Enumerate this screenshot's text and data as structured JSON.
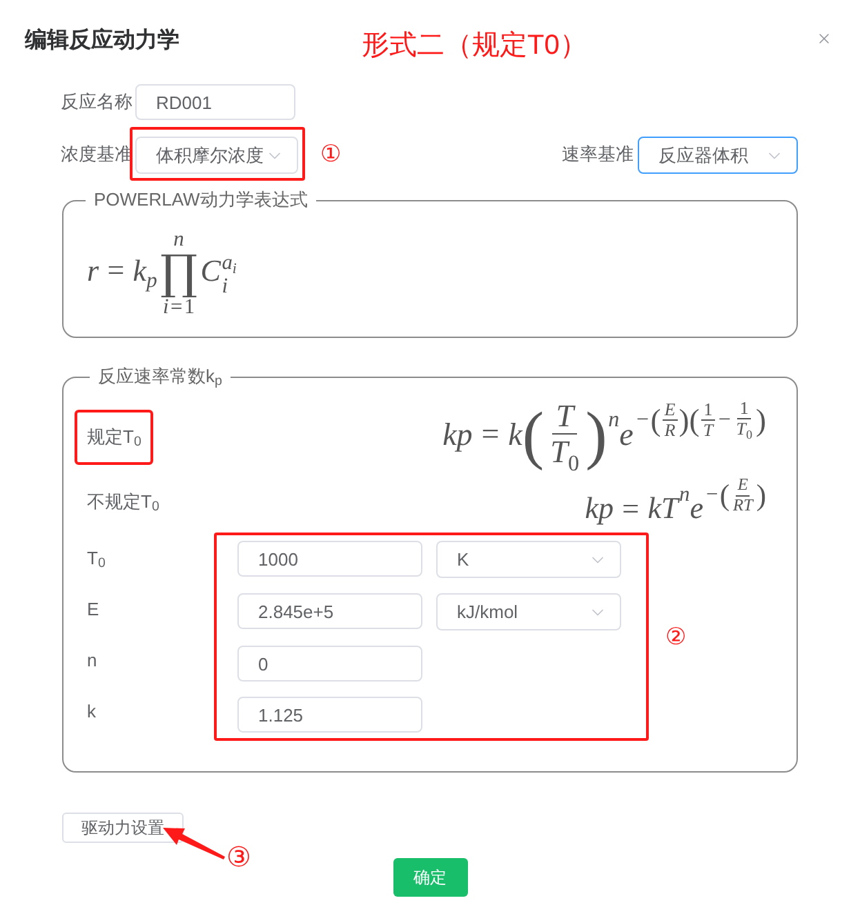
{
  "dialog": {
    "title": "编辑反应动力学"
  },
  "annotation": {
    "title": "形式二（规定T0）"
  },
  "reaction_name": {
    "label": "反应名称",
    "value": "RD001"
  },
  "concentration_basis": {
    "label": "浓度基准",
    "value": "体积摩尔浓度",
    "focused": false,
    "highlighted": true,
    "marker": "①"
  },
  "rate_basis": {
    "label": "速率基准",
    "value": "反应器体积",
    "focused": true,
    "highlighted": false
  },
  "powerlaw": {
    "legend": "POWERLAW动力学表达式",
    "formula": [
      {
        "kind": "var",
        "text": "r"
      },
      {
        "kind": "op",
        "text": "="
      },
      {
        "kind": "var",
        "text": "k"
      },
      {
        "kind": "sub",
        "items": [
          {
            "kind": "var",
            "text": "p"
          }
        ]
      },
      {
        "kind": "bigop",
        "text": "∏",
        "over": [
          {
            "kind": "var",
            "text": "n"
          }
        ],
        "under": [
          {
            "kind": "var",
            "text": "i"
          },
          {
            "kind": "op",
            "text": "="
          },
          {
            "kind": "num",
            "text": "1"
          }
        ]
      },
      {
        "kind": "var",
        "text": "C"
      },
      {
        "kind": "subsup",
        "sub": [
          {
            "kind": "var",
            "text": "i"
          }
        ],
        "sup": [
          {
            "kind": "var",
            "text": "a"
          },
          {
            "kind": "sub",
            "items": [
              {
                "kind": "var",
                "text": "i"
              }
            ]
          }
        ]
      }
    ]
  },
  "rate_constant": {
    "legend": "反应速率常数k$_{p}$",
    "options": [
      {
        "label": "规定T$_{0}$",
        "highlighted": true,
        "formula": [
          {
            "kind": "var",
            "text": "kp"
          },
          {
            "kind": "op",
            "text": "="
          },
          {
            "kind": "var",
            "text": "k"
          },
          {
            "kind": "paren",
            "open": "(",
            "close": ")",
            "items": [
              {
                "kind": "frac",
                "num": [
                  {
                    "kind": "var",
                    "text": "T"
                  }
                ],
                "den": [
                  {
                    "kind": "var",
                    "text": "T"
                  },
                  {
                    "kind": "sub",
                    "items": [
                      {
                        "kind": "num",
                        "text": "0"
                      }
                    ]
                  }
                ]
              }
            ]
          },
          {
            "kind": "sup",
            "items": [
              {
                "kind": "var",
                "text": "n"
              }
            ]
          },
          {
            "kind": "var",
            "text": "e"
          },
          {
            "kind": "sup",
            "items": [
              {
                "kind": "op",
                "text": "−"
              },
              {
                "kind": "paren",
                "open": "(",
                "close": ")",
                "items": [
                  {
                    "kind": "frac",
                    "num": [
                      {
                        "kind": "var",
                        "text": "E"
                      }
                    ],
                    "den": [
                      {
                        "kind": "var",
                        "text": "R"
                      }
                    ]
                  }
                ]
              },
              {
                "kind": "paren",
                "open": "(",
                "close": ")",
                "items": [
                  {
                    "kind": "frac",
                    "num": [
                      {
                        "kind": "num",
                        "text": "1"
                      }
                    ],
                    "den": [
                      {
                        "kind": "var",
                        "text": "T"
                      }
                    ]
                  },
                  {
                    "kind": "op",
                    "text": "−"
                  },
                  {
                    "kind": "frac",
                    "num": [
                      {
                        "kind": "num",
                        "text": "1"
                      }
                    ],
                    "den": [
                      {
                        "kind": "var",
                        "text": "T"
                      },
                      {
                        "kind": "sub",
                        "items": [
                          {
                            "kind": "num",
                            "text": "0"
                          }
                        ]
                      }
                    ]
                  }
                ]
              }
            ]
          }
        ]
      },
      {
        "label": "不规定T$_{0}$",
        "highlighted": false,
        "formula": [
          {
            "kind": "var",
            "text": "kp"
          },
          {
            "kind": "op",
            "text": "="
          },
          {
            "kind": "var",
            "text": "kT"
          },
          {
            "kind": "sup",
            "items": [
              {
                "kind": "var",
                "text": "n"
              }
            ]
          },
          {
            "kind": "var",
            "text": "e"
          },
          {
            "kind": "sup",
            "items": [
              {
                "kind": "op",
                "text": "−"
              },
              {
                "kind": "paren",
                "open": "(",
                "close": ")",
                "items": [
                  {
                    "kind": "frac",
                    "num": [
                      {
                        "kind": "var",
                        "text": "E"
                      }
                    ],
                    "den": [
                      {
                        "kind": "var",
                        "text": "RT"
                      }
                    ]
                  }
                ]
              }
            ]
          }
        ]
      }
    ],
    "params_frame": {
      "highlighted": true,
      "marker": "②"
    },
    "params": [
      {
        "label": "T$_{0}$",
        "value": "1000",
        "unit": "K"
      },
      {
        "label": "E",
        "value": "2.845e+5",
        "unit": "kJ/kmol"
      },
      {
        "label": "n",
        "value": "0"
      },
      {
        "label": "k",
        "value": "1.125"
      }
    ]
  },
  "driving_force_button": {
    "label": "驱动力设置",
    "marker": "③"
  },
  "ok_button": {
    "label": "确定"
  }
}
